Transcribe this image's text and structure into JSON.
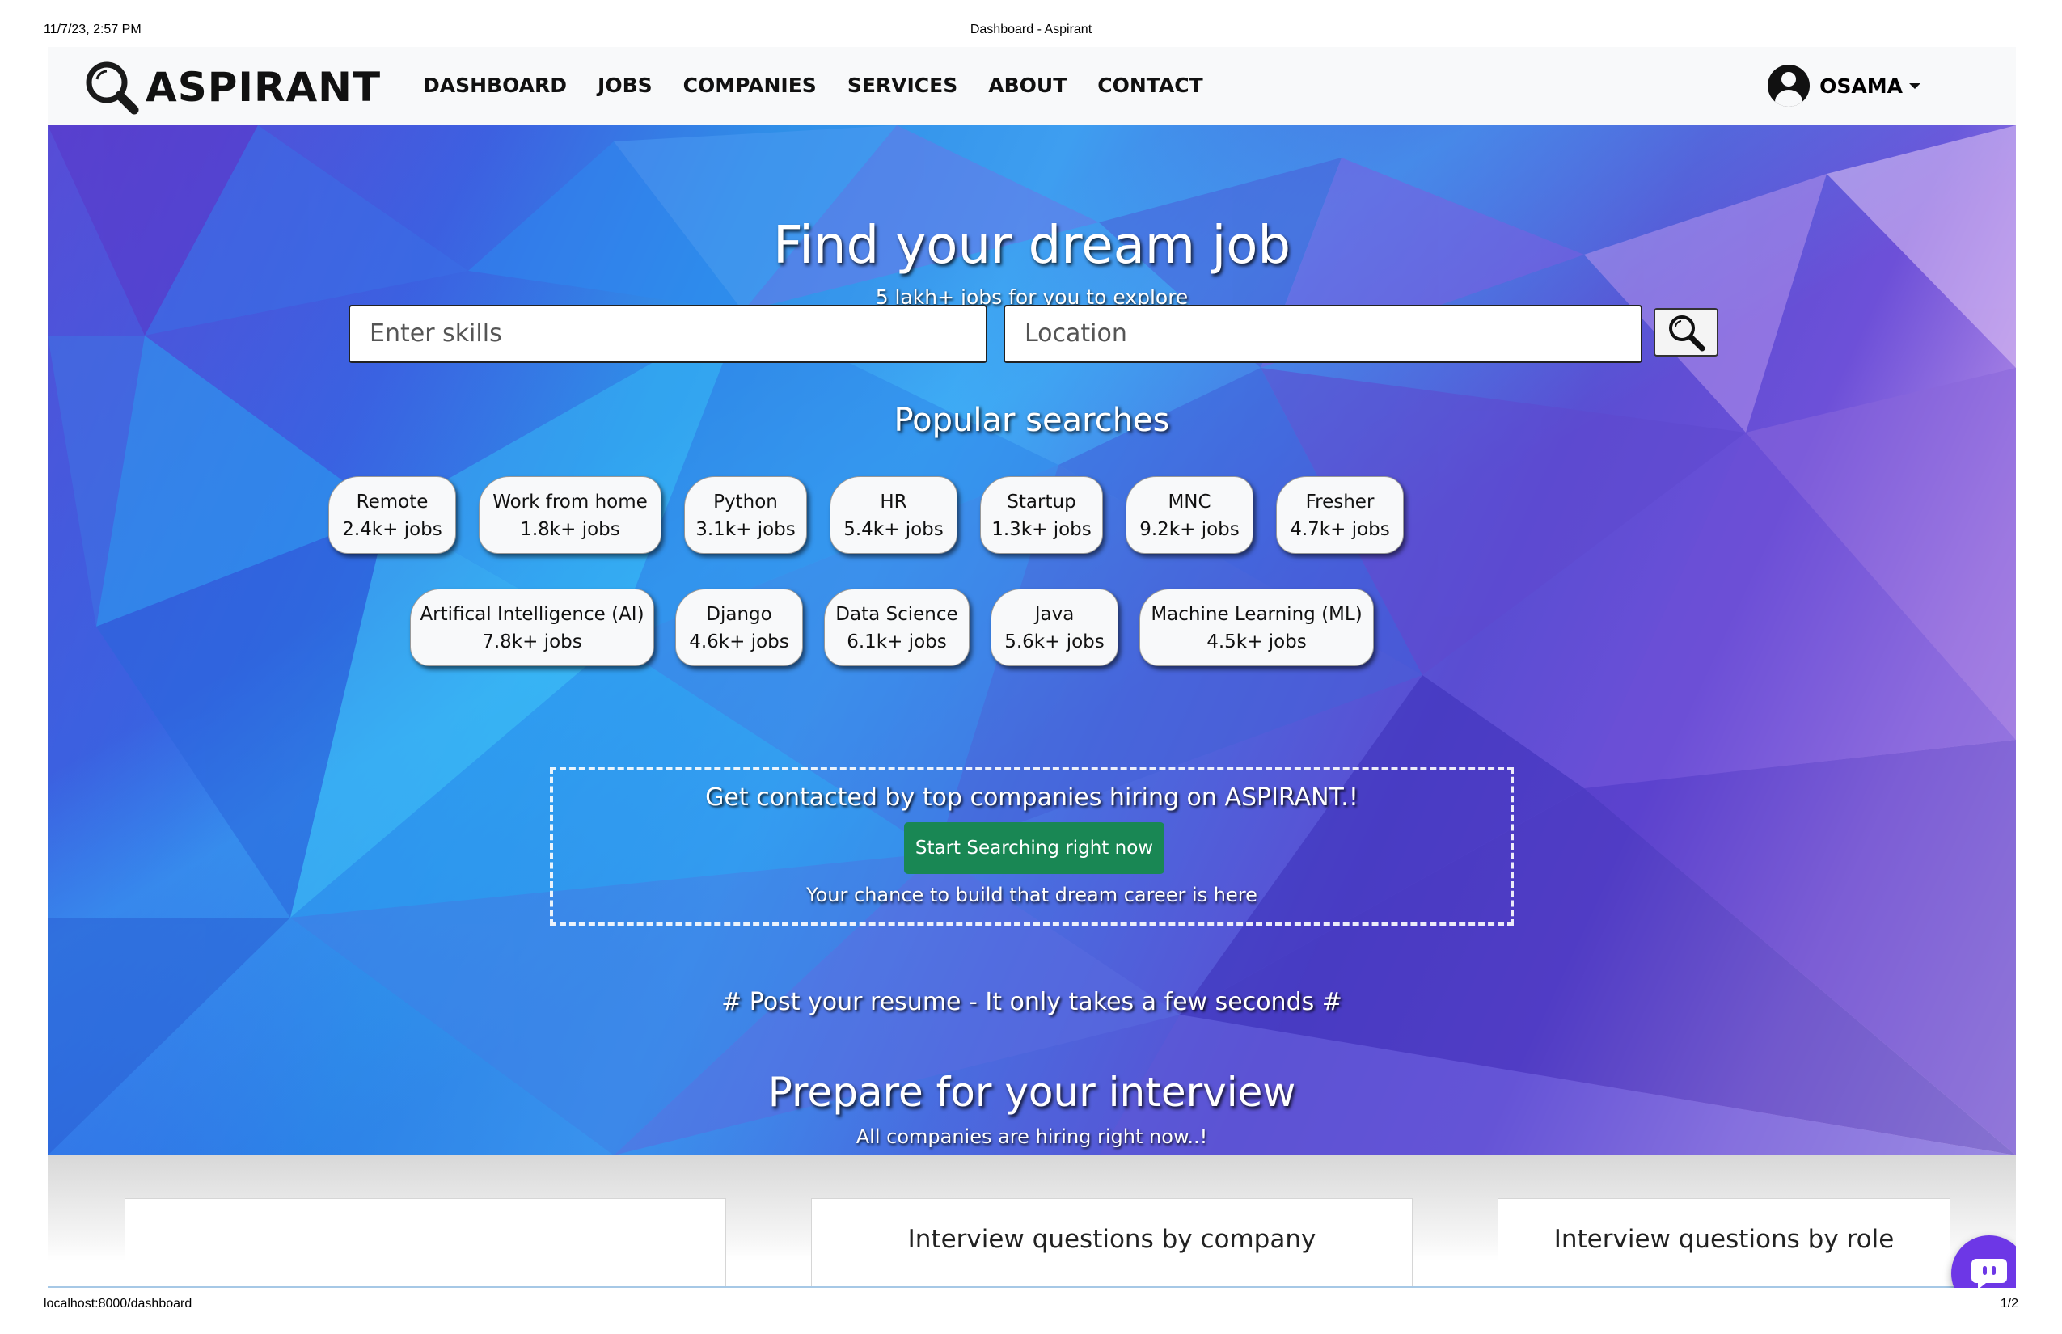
{
  "print_header": {
    "timestamp": "11/7/23, 2:57 PM",
    "doc_title": "Dashboard - Aspirant"
  },
  "print_footer": {
    "url": "localhost:8000/dashboard",
    "page": "1/2"
  },
  "navbar": {
    "brand": "ASPIRANT",
    "links": [
      "DASHBOARD",
      "JOBS",
      "COMPANIES",
      "SERVICES",
      "ABOUT",
      "CONTACT"
    ],
    "user": "OSAMA"
  },
  "hero": {
    "title": "Find your dream job",
    "subtitle": "5 lakh+ jobs for you to explore",
    "search": {
      "skills_placeholder": "Enter skills",
      "location_placeholder": "Location"
    }
  },
  "popular": {
    "title": "Popular searches",
    "row1": [
      {
        "name": "Remote",
        "count": "2.4k+ jobs"
      },
      {
        "name": "Work from home",
        "count": "1.8k+ jobs"
      },
      {
        "name": "Python",
        "count": "3.1k+ jobs"
      },
      {
        "name": "HR",
        "count": "5.4k+ jobs"
      },
      {
        "name": "Startup",
        "count": "1.3k+ jobs"
      },
      {
        "name": "MNC",
        "count": "9.2k+ jobs"
      },
      {
        "name": "Fresher",
        "count": "4.7k+ jobs"
      }
    ],
    "row2": [
      {
        "name": "Artifical Intelligence (AI)",
        "count": "7.8k+ jobs"
      },
      {
        "name": "Django",
        "count": "4.6k+ jobs"
      },
      {
        "name": "Data Science",
        "count": "6.1k+ jobs"
      },
      {
        "name": "Java",
        "count": "5.6k+ jobs"
      },
      {
        "name": "Machine Learning (ML)",
        "count": "4.5k+ jobs"
      }
    ]
  },
  "cta": {
    "text": "Get contacted by top companies hiring on ASPIRANT.!",
    "button": "Start Searching right now",
    "note": "Your chance to build that dream career is here"
  },
  "post_resume": "# Post your resume - It only takes a few seconds #",
  "prepare": {
    "title": "Prepare for your interview",
    "subtitle": "All companies are hiring right now..!"
  },
  "cards": [
    "",
    "Interview questions by company",
    "Interview questions by role"
  ],
  "colors": {
    "accent_green": "#198754",
    "chat_purple": "#6d37e6",
    "navbar_bg": "#f8f9fa"
  },
  "icons": {
    "brand": "magnifier-icon",
    "search": "search-icon",
    "user": "user-avatar-icon",
    "chat": "chat-icon"
  }
}
